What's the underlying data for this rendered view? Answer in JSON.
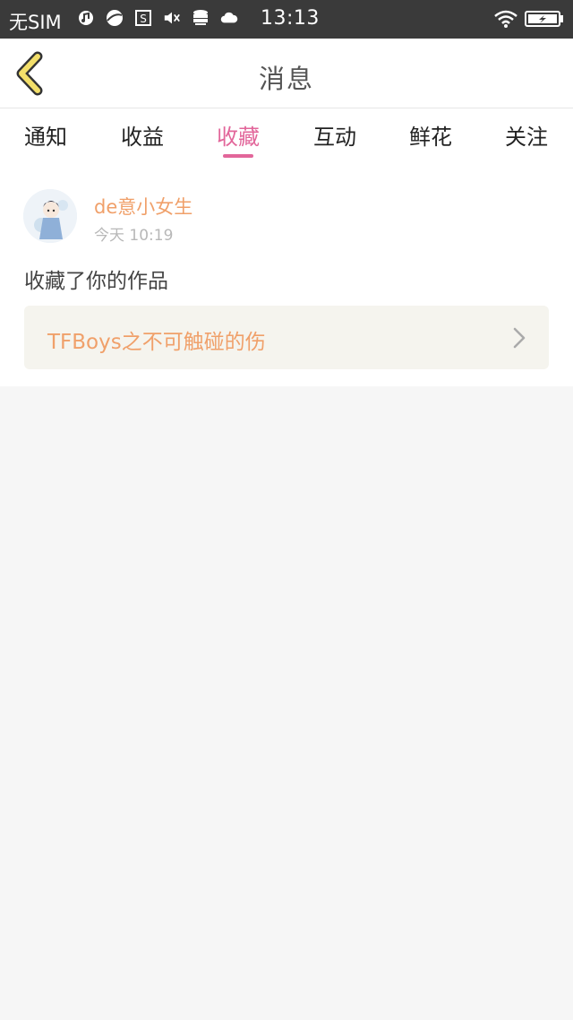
{
  "status_bar": {
    "carrier": "无SIM",
    "time": "13:13"
  },
  "header": {
    "title": "消息"
  },
  "tabs": [
    {
      "label": "通知"
    },
    {
      "label": "收益"
    },
    {
      "label": "收藏",
      "active": true
    },
    {
      "label": "互动"
    },
    {
      "label": "鲜花"
    },
    {
      "label": "关注"
    }
  ],
  "message": {
    "username": "de意小女生",
    "timestamp": "今天 10:19",
    "action": "收藏了你的作品",
    "work_title": "TFBoys之不可触碰的伤"
  },
  "colors": {
    "accent_pink": "#e2669a",
    "name_orange": "#f0a06a",
    "back_arrow_yellow": "#f3df6a"
  }
}
